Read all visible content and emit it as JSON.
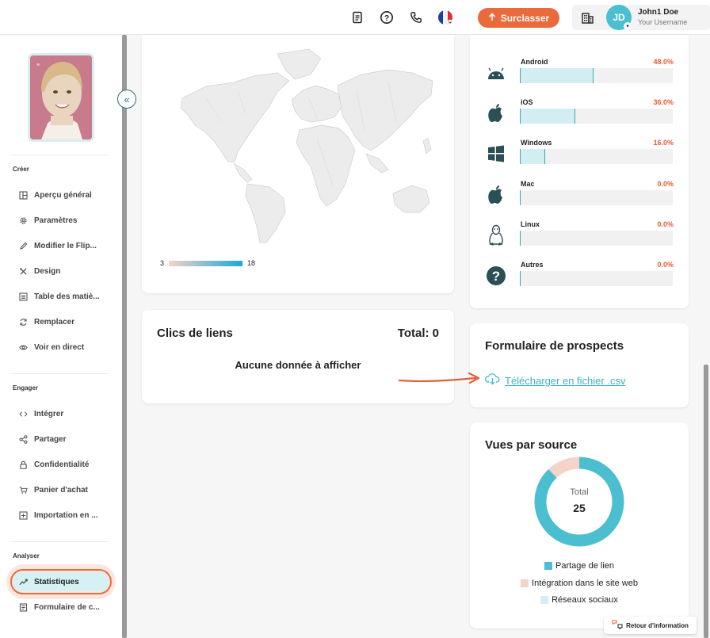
{
  "topbar": {
    "icons": [
      "document-icon",
      "help-icon",
      "phone-icon",
      "french-flag-icon"
    ],
    "upgrade_label": "Surclasser",
    "avatar_initials": "JD",
    "user_name": "John1 Doe",
    "user_sub": "Your Username",
    "colors": {
      "accent": "#ea6a3c",
      "avatar": "#4bbfcf"
    }
  },
  "sidebar": {
    "sections": [
      {
        "title": "Créer",
        "items": [
          "Aperçu général",
          "Paramètres",
          "Modifier le Flip...",
          "Design",
          "Table des matiè...",
          "Remplacer",
          "Voir en direct"
        ]
      },
      {
        "title": "Engager",
        "items": [
          "Intégrer",
          "Partager",
          "Confidentialité",
          "Panier d'achat",
          "Importation en ..."
        ]
      },
      {
        "title": "Analyser",
        "items": [
          "Statistiques",
          "Formulaire de c..."
        ]
      }
    ],
    "active": "Statistiques"
  },
  "map": {
    "legend_min": "3",
    "legend_max": "18"
  },
  "clicks": {
    "title": "Clics de liens",
    "total": "Total: 0",
    "empty": "Aucune donnée à afficher"
  },
  "os": [
    {
      "name": "Android",
      "pct": "48.0%",
      "value": 48,
      "icon": "android-icon"
    },
    {
      "name": "iOS",
      "pct": "36.0%",
      "value": 36,
      "icon": "apple-icon"
    },
    {
      "name": "Windows",
      "pct": "16.0%",
      "value": 16,
      "icon": "windows-icon"
    },
    {
      "name": "Mac",
      "pct": "0.0%",
      "value": 0,
      "icon": "apple-icon"
    },
    {
      "name": "Linux",
      "pct": "0.0%",
      "value": 0,
      "icon": "linux-icon"
    },
    {
      "name": "Autres",
      "pct": "0.0%",
      "value": 0,
      "icon": "question-icon"
    }
  ],
  "leads": {
    "title": "Formulaire de prospects",
    "download": "Télécharger en fichier .csv"
  },
  "sources": {
    "title": "Vues par source",
    "total_label": "Total",
    "total": "25",
    "legend": [
      {
        "label": "Partage de lien",
        "color": "#4bbfcf",
        "value": 22
      },
      {
        "label": "Intégration dans le site web",
        "color": "#f6d3c8",
        "value": 3
      },
      {
        "label": "Réseaux sociaux",
        "color": "#d6ecf1",
        "value": 0
      }
    ]
  },
  "retour_label": "Retour d'information"
}
